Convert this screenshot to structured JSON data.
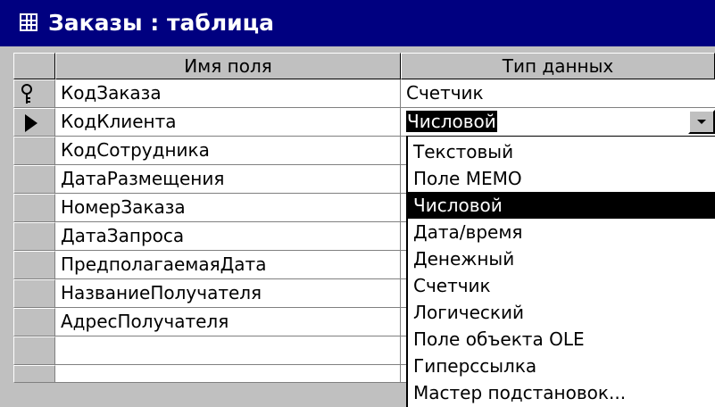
{
  "window": {
    "title": "Заказы : таблица"
  },
  "columns": {
    "field_name": "Имя поля",
    "data_type": "Тип данных"
  },
  "rows": [
    {
      "field": "КодЗаказа",
      "type": "Счетчик"
    },
    {
      "field": "КодКлиента",
      "type": "Числовой"
    },
    {
      "field": "КодСотрудника"
    },
    {
      "field": "ДатаРазмещения"
    },
    {
      "field": "НомерЗаказа"
    },
    {
      "field": "ДатаЗапроса"
    },
    {
      "field": "ПредполагаемаяДата"
    },
    {
      "field": "НазваниеПолучателя"
    },
    {
      "field": "АдресПолучателя"
    },
    {
      "field": ""
    },
    {
      "field": ""
    }
  ],
  "dropdown": {
    "selected": "Числовой",
    "options": [
      "Текстовый",
      "Поле MEMO",
      "Числовой",
      "Дата/время",
      "Денежный",
      "Счетчик",
      "Логический",
      "Поле объекта OLE",
      "Гиперссылка",
      "Мастер подстановок..."
    ]
  },
  "icons": {
    "title": "table-icon",
    "row_key": "primary-key-icon",
    "row_current": "current-row-arrow-icon",
    "combo": "dropdown-arrow-icon"
  },
  "colors": {
    "titlebar": "#000080",
    "selection": "#000000",
    "face": "#c0c0c0"
  }
}
